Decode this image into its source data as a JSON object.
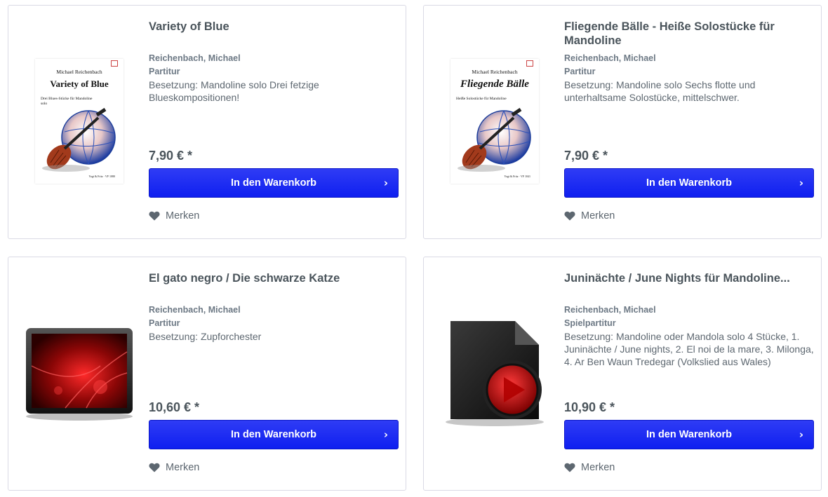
{
  "products": [
    {
      "title": "Variety of Blue",
      "author": "Reichenbach, Michael",
      "type": "Partitur",
      "description": "Besetzung: Mandoline solo Drei fetzige Blueskompositionen!",
      "price": "7,90 € *",
      "buy_label": "In den Warenkorb",
      "note_label": "Merken",
      "cover": {
        "author": "Michael Reichenbach",
        "title": "Variety of Blue",
        "subtitle": "Drei Blues-Stücke für Mandoline solo",
        "footer": "Vogt & Fritz · VF 1080"
      }
    },
    {
      "title": "Fliegende Bälle - Heiße Solostücke für Mandoline",
      "author": "Reichenbach, Michael",
      "type": "Partitur",
      "description": "Besetzung: Mandoline solo Sechs flotte und unterhaltsame Solostücke, mittelschwer.",
      "price": "7,90 € *",
      "buy_label": "In den Warenkorb",
      "note_label": "Merken",
      "cover": {
        "author": "Michael Reichenbach",
        "title": "Fliegende Bälle",
        "subtitle": "Heiße Solostücke für Mandoline",
        "footer": "Vogt & Fritz · VF 1041"
      }
    },
    {
      "title": "El gato negro / Die schwarze Katze",
      "author": "Reichenbach, Michael",
      "type": "Partitur",
      "description": "Besetzung: Zupforchester",
      "price": "10,60 € *",
      "buy_label": "In den Warenkorb",
      "note_label": "Merken"
    },
    {
      "title": "Juninächte / June Nights für Mandoline...",
      "author": "Reichenbach, Michael",
      "type": "Spielpartitur",
      "description": "Besetzung: Mandoline oder Mandola solo 4 Stücke, 1. Juninächte / June nights, 2. El noi de la mare, 3. Milonga, 4. Ar Ben Waun Tredegar (Volkslied aus Wales)",
      "price": "10,90 € *",
      "buy_label": "In den Warenkorb",
      "note_label": "Merken"
    }
  ],
  "colors": {
    "button": "#1424f0",
    "card_border": "#dadae5",
    "text": "#4a545b"
  }
}
